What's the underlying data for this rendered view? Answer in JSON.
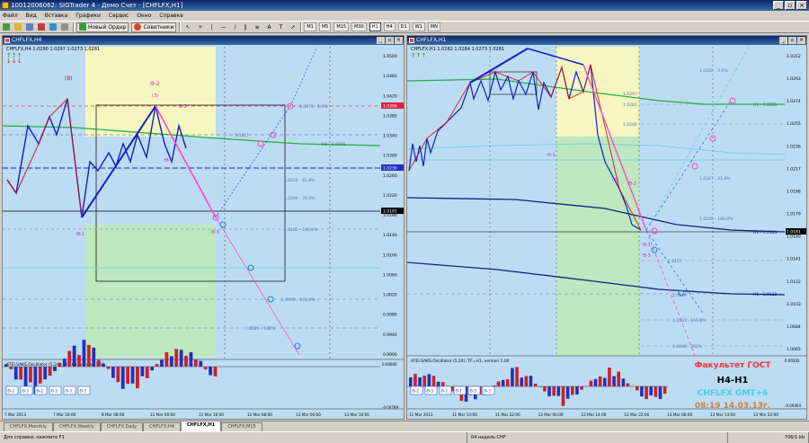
{
  "window": {
    "title": "10012006062: SIGTrader 4 - Демо Счет - [CHFLFX,H1]",
    "controls": [
      "_",
      "▫",
      "×"
    ]
  },
  "menu": [
    "Файл",
    "Вид",
    "Вставка",
    "Графики",
    "Сервис",
    "Окно",
    "Справка"
  ],
  "toolbar": {
    "new_order": "Новый Ордер",
    "advisors": "Советники",
    "timeframes": [
      "M1",
      "M5",
      "M15",
      "M30",
      "H1",
      "H4",
      "D1",
      "W1",
      "MN"
    ],
    "active_tf": "H1"
  },
  "charts": {
    "left": {
      "title": "CHFLFX,H4",
      "info": "CHFLFX,H4  1.0290 1.0297 1.0273 1.0281",
      "prices": [
        "1.0500",
        "1.0460",
        "1.0420",
        "1.0380",
        "1.0340",
        "1.0300",
        "1.0260",
        "1.0220",
        "1.0180",
        "1.0140",
        "1.0100",
        "1.0060",
        "1.0020",
        "0.9980",
        "0.9940",
        "0.9900"
      ],
      "price_highlight": "1.0306",
      "price_mark_blue": "1.0230",
      "price_current": "1.0181",
      "dates": [
        "7 Mar 2013",
        "7 Mar 16:00",
        "8 Mar 08:00",
        "11 Mar 00:00",
        "11 Mar 16:00",
        "12 Mar 08:00",
        "13 Mar 00:00",
        "13 Mar 16:00"
      ],
      "osc_title": "ATEI.SAKS.Oscillator (5,24), TF=H4, version 1.00",
      "osc_scale": [
        "0.00000",
        "-0.00788"
      ],
      "osc_tags": [
        "Θ-2",
        "Θ-3",
        "Θ-2",
        "Θ-3",
        "Θ-3",
        "Θ-3"
      ],
      "labels": {
        "a": "(8)",
        "b": "Θ-2",
        "c": "(3)",
        "d": "Θ-1",
        "e": "Θ-3",
        "f": "Θ-2",
        "g": "Θ-1"
      },
      "fib": [
        "1.0227",
        "1.0224 - 61.8%",
        "1.0206 - 76.4%",
        "1.0165 - 100.0%",
        "1.0060 - 161.8%",
        "1.0026 - 180%",
        "1.0275 - 1.0%"
      ],
      "ma_label": "H1 - 1.0265"
    },
    "right": {
      "title": "CHFLFX,H1",
      "info": "CHFLFX,H1  1.0282 1.0284 1.0273 1.0281",
      "prices": [
        "1.0312",
        "1.0293",
        "1.0274",
        "1.0255",
        "1.0236",
        "1.0217",
        "1.0198",
        "1.0179",
        "1.0160",
        "1.0141",
        "1.0122",
        "1.0103",
        "1.0084",
        "1.0065"
      ],
      "price_current": "1.0181",
      "dates": [
        "11 Mar 2013",
        "11 Mar 14:00",
        "11 Mar 22:00",
        "12 Mar 06:00",
        "12 Mar 14:00",
        "12 Mar 22:00",
        "13 Mar 06:00",
        "13 Mar 14:00",
        "13 Mar 22:00"
      ],
      "osc_title": "ATEI.SAKS.Oscillator (5,24), TF=H1, version 1.00",
      "osc_scale": [
        "0.00202",
        "-0.00464"
      ],
      "osc_tags": [
        "Θ-2",
        "Θ-3",
        "Θ-2",
        "Θ-1",
        "Θ-3",
        "Θ-3"
      ],
      "labels": {
        "a": "Θ-1",
        "b": "(3)",
        "c": "Θ-2",
        "d": "Θ-3",
        "e": "Θ-1"
      },
      "fib": [
        "1.0297",
        "1.0281",
        "1.0206",
        "1.0157",
        "1.0131 - 161.8%",
        "1.0118",
        "1.0096 - 200%",
        "1.0282 - 0.0%",
        "1.0247 - 61.8%",
        "1.0229 - 100.0%"
      ],
      "ma_labels": [
        "H1 - 1.0285",
        "H1 - 1.0185",
        "H1 - 1.0122"
      ]
    }
  },
  "overlay": {
    "line1": "Факультет ГОСТ",
    "line2": "H4-H1",
    "line3": "CHFLFX  GMT+6",
    "line4": "08:19  14.03.13г.",
    "colors": {
      "line1": "#ff3030",
      "line2": "#000000",
      "line3": "#40d0e0",
      "line4": "#d08040"
    }
  },
  "tabs": [
    "CHFLFX,Monthly",
    "CHFLFX,Weekly",
    "CHFLFX,Daily",
    "CHFLFX,H4",
    "CHFLFX,H1",
    "CHFLFX,M15"
  ],
  "active_tab": "CHFLFX,H1",
  "status": {
    "help": "Для справки, нажмите F1",
    "profile": "04 недель CHF",
    "traffic": "706/1 kb"
  },
  "colors": {
    "chart_bg": "#bcdcf4",
    "up": "#1020c0",
    "down": "#d01010",
    "pink": "#ff40c0",
    "ma_green": "#20b040",
    "ma_blue": "#102080"
  }
}
